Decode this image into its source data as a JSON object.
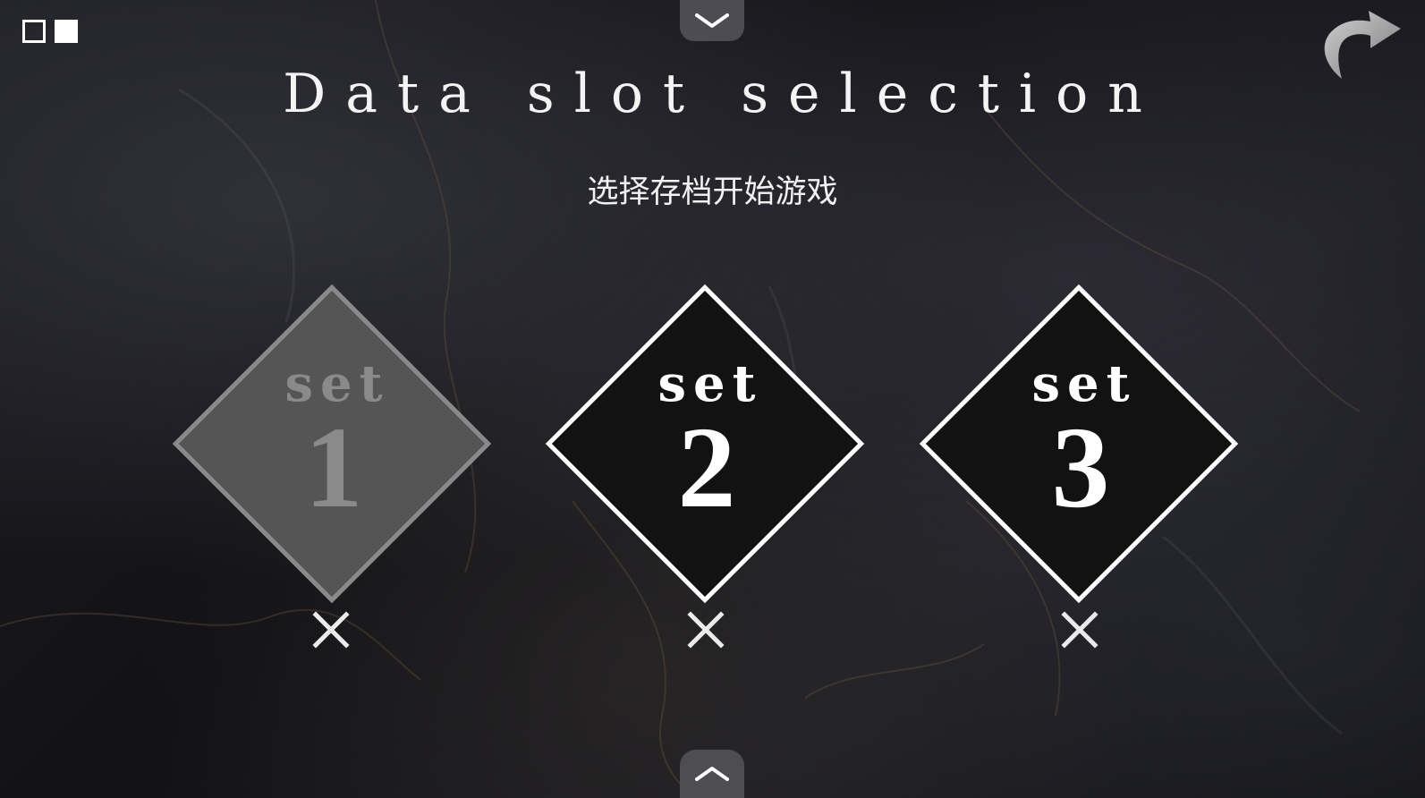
{
  "title": "Data slot selection",
  "subtitle": "选择存档开始游戏",
  "toggles": [
    {
      "icon": "outline-square-icon"
    },
    {
      "icon": "filled-square-icon"
    }
  ],
  "top_tab": {
    "icon": "chevron-down-icon"
  },
  "bottom_tab": {
    "icon": "chevron-up-icon"
  },
  "back": {
    "icon": "curved-back-arrow-icon"
  },
  "slots": [
    {
      "word": "set",
      "number": "1",
      "state": "disabled",
      "delete_icon": "close-icon"
    },
    {
      "word": "set",
      "number": "2",
      "state": "active",
      "delete_icon": "close-icon"
    },
    {
      "word": "set",
      "number": "3",
      "state": "active",
      "delete_icon": "close-icon"
    }
  ],
  "colors": {
    "background": "#16161a",
    "active_diamond": "#121212",
    "disabled_diamond": "#555555",
    "border": "#ffffff",
    "disabled_text": "#8a8a8a"
  }
}
